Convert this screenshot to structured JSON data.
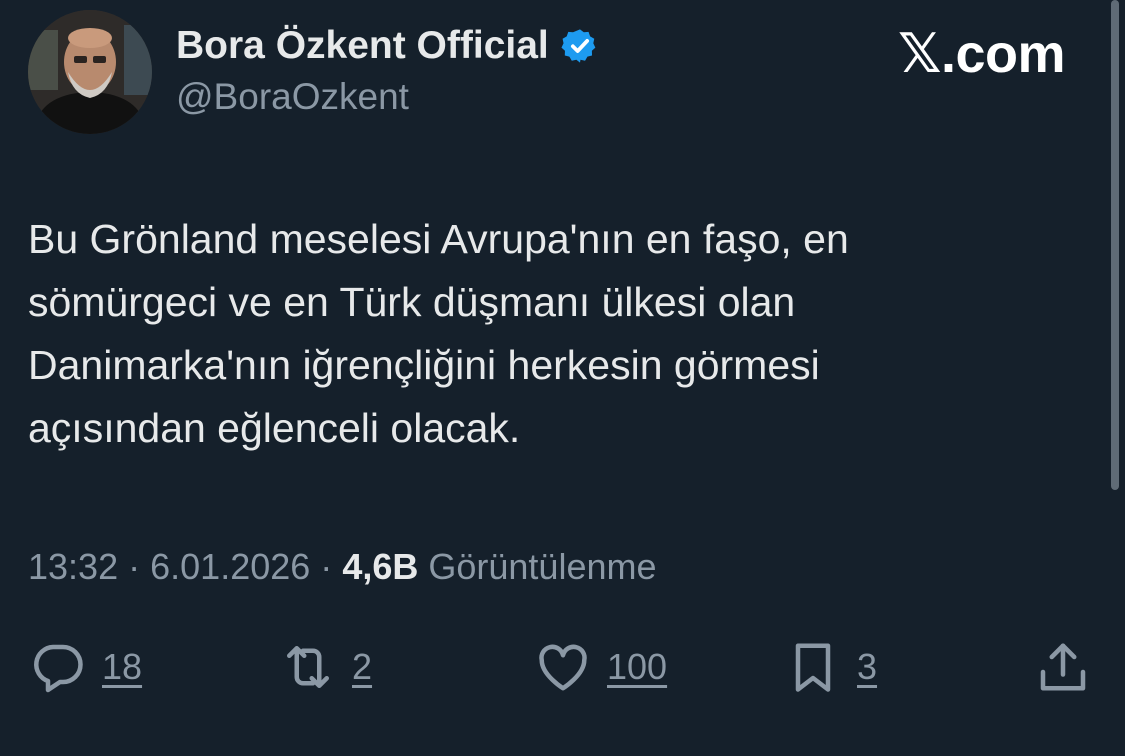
{
  "author": {
    "display_name": "Bora Özkent Official",
    "handle": "@BoraOzkent",
    "verified": true
  },
  "brand": "𝕏.com",
  "tweet": {
    "lines": [
      "Bu Grönland meselesi Avrupa'nın en faşo, en",
      "sömürgeci ve en Türk düşmanı ülkesi olan",
      "Danimarka'nın iğrençliğini herkesin görmesi",
      "açısından eğlenceli olacak."
    ]
  },
  "meta": {
    "time": "13:32",
    "separator": "·",
    "date": "6.01.2026",
    "views_count": "4,6B",
    "views_label": "Görüntülenme"
  },
  "actions": {
    "replies": "18",
    "reposts": "2",
    "likes": "100",
    "bookmarks": "3"
  },
  "icons": {
    "reply": "speech-bubble-icon",
    "repost": "repost-arrows-icon",
    "like": "heart-icon",
    "bookmark": "bookmark-icon",
    "share": "share-upload-icon",
    "verified": "verified-badge-icon"
  },
  "colors": {
    "background": "#15202b",
    "primary_text": "#e7e9ea",
    "secondary_text": "#8b98a5",
    "verified_blue": "#1d9bf0"
  }
}
